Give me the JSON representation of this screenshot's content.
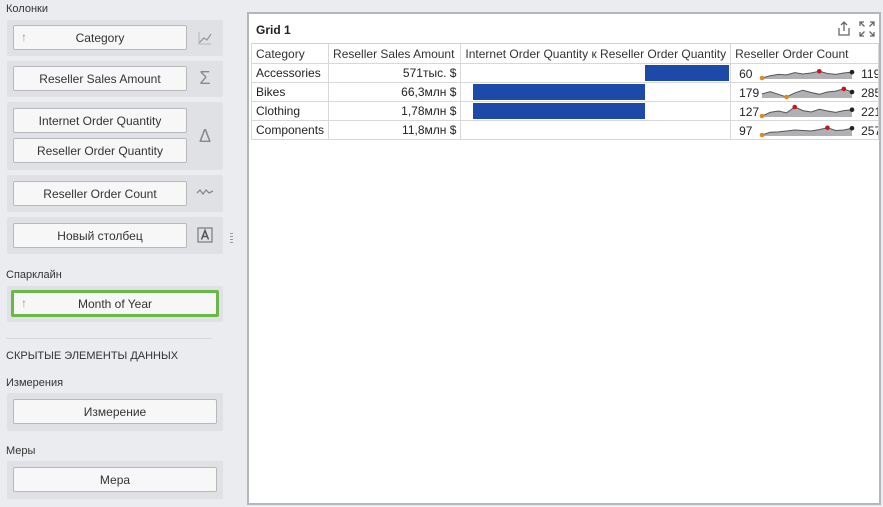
{
  "panel": {
    "columns_label": "Колонки",
    "columns": [
      {
        "label": "Category",
        "icon": "chart-icon"
      },
      {
        "label": "Reseller Sales Amount",
        "icon": "sigma-icon"
      },
      {
        "label": "Internet Order Quantity",
        "icon": "delta-icon"
      },
      {
        "label": "Reseller Order Quantity",
        "icon": "delta-icon"
      },
      {
        "label": "Reseller Order Count",
        "icon": "sparkline-icon"
      },
      {
        "label": "Новый столбец",
        "icon": "text-column-icon"
      }
    ],
    "sparkline_label": "Спарклайн",
    "sparkline_argument": "Month of Year",
    "hidden_header": "СКРЫТЫЕ ЭЛЕМЕНТЫ ДАННЫХ",
    "dimensions_label": "Измерения",
    "dimension_placeholder": "Измерение",
    "measures_label": "Меры",
    "measure_placeholder": "Мера"
  },
  "grid": {
    "title": "Grid 1",
    "headers": [
      "Category",
      "Reseller Sales Amount",
      "Internet Order Quantity к Reseller Order Quantity",
      "Reseller Order Count"
    ],
    "rows": [
      {
        "category": "Accessories",
        "amount": "571тыс. $",
        "delta": 0.31,
        "spark_start": "60",
        "spark_end": "119",
        "spark": [
          0.0,
          0.25,
          0.4,
          0.35,
          0.6,
          0.45,
          0.55,
          0.75,
          0.5,
          0.4,
          0.55,
          0.65
        ]
      },
      {
        "category": "Bikes",
        "amount": "66,3млн $",
        "delta": -1.0,
        "spark_start": "179",
        "spark_end": "285",
        "spark": [
          0.35,
          0.6,
          0.3,
          0.0,
          0.45,
          0.75,
          0.5,
          0.3,
          0.55,
          0.65,
          0.9,
          0.55
        ]
      },
      {
        "category": "Clothing",
        "amount": "1,78млн $",
        "delta": -1.0,
        "spark_start": "127",
        "spark_end": "221",
        "spark": [
          0.0,
          0.4,
          0.55,
          0.35,
          1.0,
          0.6,
          0.45,
          0.75,
          0.55,
          0.4,
          0.6,
          0.7
        ]
      },
      {
        "category": "Components",
        "amount": "11,8млн $",
        "delta": 0.0,
        "spark_start": "97",
        "spark_end": "257",
        "spark": [
          0.0,
          0.3,
          0.35,
          0.45,
          0.55,
          0.5,
          0.45,
          0.6,
          0.8,
          0.5,
          0.55,
          0.75
        ]
      }
    ]
  },
  "colors": {
    "bar": "#1d49a8",
    "highlight_border": "#6ab84a",
    "spark_line": "#555555",
    "spark_fill": "#b0b0b4",
    "spark_min_point": "#e08a1c",
    "spark_max_point": "#c0191f",
    "spark_end_point": "#222222"
  }
}
